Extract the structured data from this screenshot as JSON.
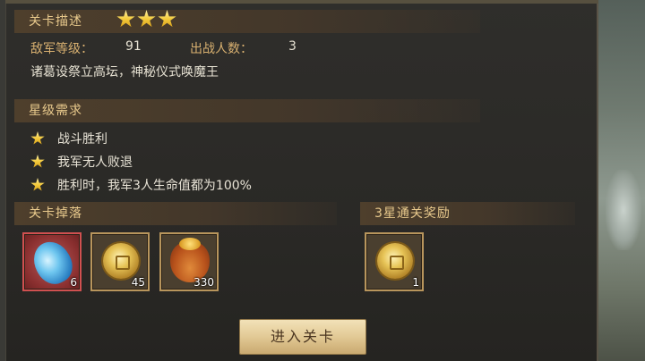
{
  "header": {
    "title": "关卡描述",
    "stars": 3
  },
  "info": {
    "enemy_level_label": "敌军等级：",
    "enemy_level_value": "91",
    "troops_label": "出战人数：",
    "troops_value": "3",
    "description": "诸葛设祭立高坛，神秘仪式唤魔王"
  },
  "requirements": {
    "title": "星级需求",
    "items": [
      {
        "text": "战斗胜利",
        "icon": "star-icon"
      },
      {
        "text": "我军无人败退",
        "icon": "star-icon"
      },
      {
        "text": "胜利时，我军3人生命值都为100%",
        "icon": "star-icon"
      }
    ]
  },
  "drops": {
    "title": "关卡掉落",
    "items": [
      {
        "icon": "blue-gem-icon",
        "count": "6"
      },
      {
        "icon": "gold-coin-icon",
        "count": "45"
      },
      {
        "icon": "money-bag-icon",
        "count": "330"
      }
    ]
  },
  "reward": {
    "title": "3星通关奖励",
    "items": [
      {
        "icon": "gold-coin-icon",
        "count": "1"
      }
    ]
  },
  "enter_button": {
    "label": "进入关卡"
  },
  "colors": {
    "header_text": "#e8c98c",
    "label_text": "#d8b070",
    "body_text": "#e6e1d2",
    "star": "#f3c93a",
    "item_border": "#b8955c",
    "item_border_selected": "#d05050"
  }
}
